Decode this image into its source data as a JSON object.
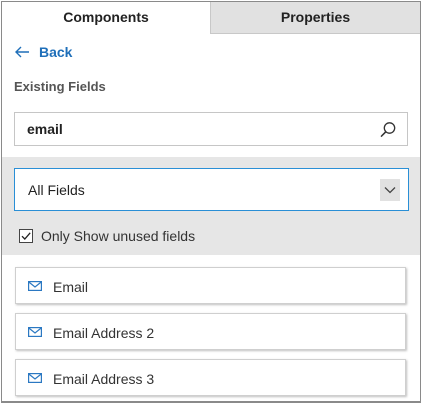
{
  "tabs": [
    {
      "label": "Components",
      "active": true
    },
    {
      "label": "Properties",
      "active": false
    }
  ],
  "back": {
    "label": "Back",
    "icon": "arrow-left-icon"
  },
  "section": {
    "title": "Existing Fields"
  },
  "search": {
    "value": "email",
    "placeholder": "",
    "icon": "search-icon"
  },
  "filter": {
    "selected": "All Fields",
    "icon": "chevron-down-icon"
  },
  "only_unused": {
    "label": "Only Show unused fields",
    "checked": true
  },
  "fields": [
    {
      "label": "Email",
      "icon": "mail-icon"
    },
    {
      "label": "Email Address 2",
      "icon": "mail-icon"
    },
    {
      "label": "Email Address 3",
      "icon": "mail-icon"
    }
  ],
  "colors": {
    "accent": "#1f6fb9",
    "focus_border": "#2a8fd6",
    "tab_inactive_bg": "#e1e1e1",
    "filter_bg": "#e6e6e6"
  }
}
